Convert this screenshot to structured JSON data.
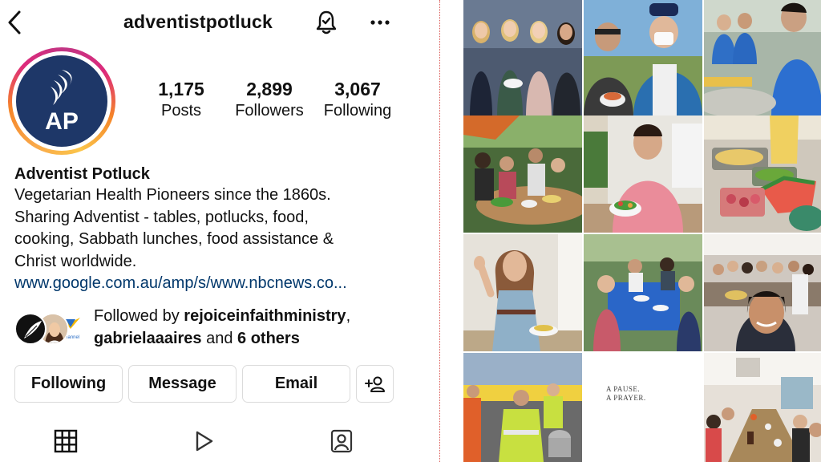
{
  "header": {
    "username": "adventistpotluck"
  },
  "profile": {
    "avatar_text": "AP",
    "stats": [
      {
        "value": "1,175",
        "label": "Posts"
      },
      {
        "value": "2,899",
        "label": "Followers"
      },
      {
        "value": "3,067",
        "label": "Following"
      }
    ],
    "display_name": "Adventist Potluck",
    "bio": "Vegetarian Health Pioneers since the 1860s.\nSharing Adventist - tables, potlucks, food,\ncooking, Sabbath lunches, food assistance &\nChrist worldwide.",
    "link": "www.google.com.au/amp/s/www.nbcnews.co..."
  },
  "followed_by": {
    "prefix": "Followed by ",
    "user1": "rejoiceinfaithministry",
    "sep": ",",
    "user2": "gabrielaaaires",
    "and": " and ",
    "others": "6 others",
    "avatar_label": "Channel"
  },
  "actions": {
    "following": "Following",
    "message": "Message",
    "email": "Email"
  },
  "grid": {
    "post_text_line1": "A PAUSE.",
    "post_text_line2": "A PRAYER."
  },
  "colors": {
    "brand_navy": "#1e3768",
    "link": "#00376b",
    "border": "#dbdbdb",
    "ring_start": "#f58529",
    "ring_mid": "#dd2a7b",
    "divider": "#d9534f"
  }
}
